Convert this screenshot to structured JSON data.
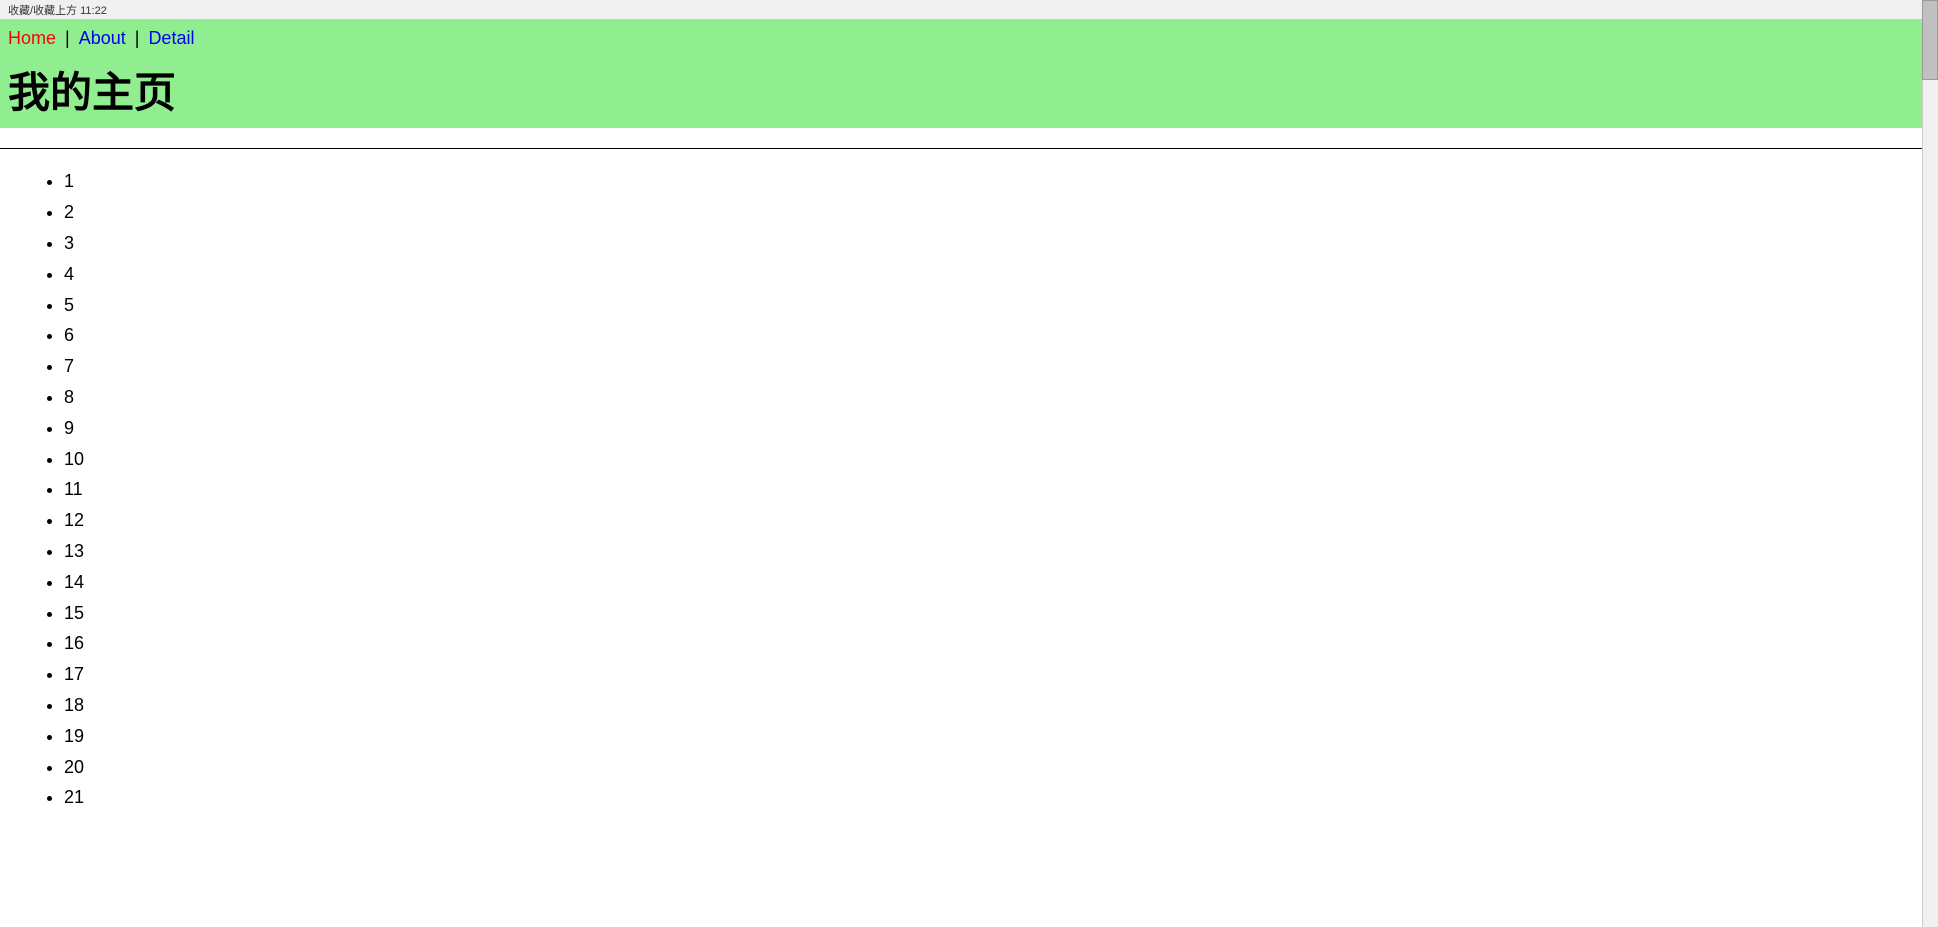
{
  "browser_bar": {
    "text": "收藏/收藏上方 11:22"
  },
  "nav": {
    "home_label": "Home",
    "separator1": "|",
    "about_label": "About",
    "separator2": "|",
    "detail_label": "Detail",
    "home_color": "#ff0000",
    "about_color": "#0000ee",
    "detail_color": "#0000ee"
  },
  "page": {
    "title": "我的主页",
    "background_color": "#90ee90"
  },
  "list": {
    "items": [
      "1",
      "2",
      "3",
      "4",
      "5",
      "6",
      "7",
      "8",
      "9",
      "10",
      "11",
      "12",
      "13",
      "14",
      "15",
      "16",
      "17",
      "18",
      "19",
      "20",
      "21"
    ]
  }
}
